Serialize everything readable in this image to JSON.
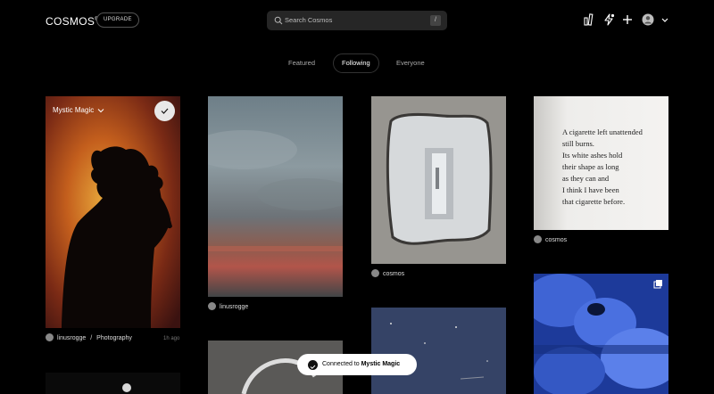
{
  "header": {
    "logo": "COSMOS",
    "logo_mark": "®",
    "upgrade_label": "UPGRADE",
    "search_placeholder": "Search Cosmos",
    "search_shortcut": "/"
  },
  "tabs": [
    {
      "label": "Featured"
    },
    {
      "label": "Following"
    },
    {
      "label": "Everyone"
    }
  ],
  "cluster_card": {
    "title": "Mystic Magic",
    "user": "linusrogge",
    "separator": "/",
    "collection": "Photography",
    "time": "1h ago"
  },
  "cards": [
    {
      "user": "linusrogge"
    },
    {
      "user": "cosmos"
    },
    {
      "user": "cosmos"
    }
  ],
  "poem": {
    "lines": "A cigarette left unattended\nstill burns.\nIts white ashes hold\ntheir shape as long\nas they can and\nI think I have been\nthat cigarette before."
  },
  "toast": {
    "prefix": "Connected to ",
    "target": "Mystic Magic"
  },
  "icons": {
    "search": "search-icon",
    "stats": "bar-chart-icon",
    "activity": "lightning-icon",
    "add": "plus-icon",
    "profile": "avatar-icon",
    "menu": "chevron-down-icon",
    "check": "check-icon",
    "multi": "stack-icon"
  }
}
